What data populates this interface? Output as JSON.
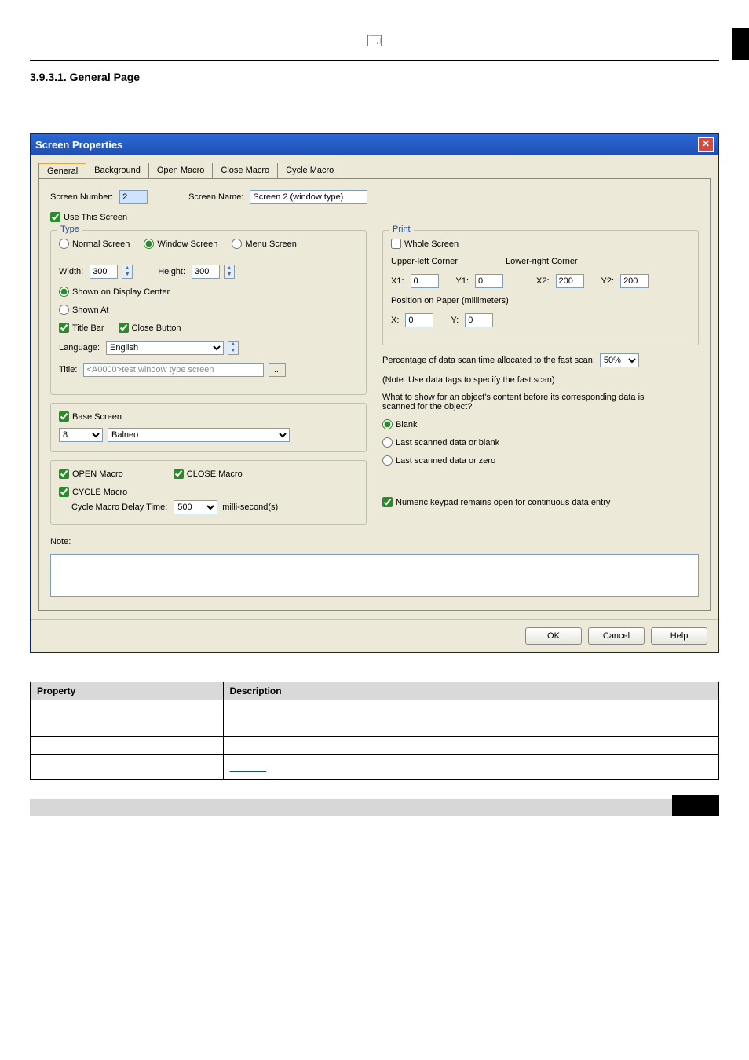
{
  "heading": "3.9.3.1.  General Page",
  "dialog_title": "Screen Properties",
  "tabs": [
    "General",
    "Background",
    "Open Macro",
    "Close Macro",
    "Cycle Macro"
  ],
  "screen_number_label": "Screen Number:",
  "screen_number_value": "2",
  "screen_name_label": "Screen Name:",
  "screen_name_value": "Screen 2 (window type)",
  "use_this_screen": "Use This Screen",
  "type_group": "Type",
  "type_options": [
    "Normal Screen",
    "Window Screen",
    "Menu Screen"
  ],
  "width_label": "Width:",
  "width_value": "300",
  "height_label": "Height:",
  "height_value": "300",
  "shown_center": "Shown on Display Center",
  "shown_at": "Shown At",
  "title_bar": "Title Bar",
  "close_button": "Close Button",
  "language_label": "Language:",
  "language_value": "English",
  "title_label": "Title:",
  "title_value": "<A0000>test window type screen",
  "base_screen": "Base Screen",
  "base_screen_num": "8",
  "base_screen_name": "Balneo",
  "open_macro": "OPEN Macro",
  "close_macro": "CLOSE Macro",
  "cycle_macro": "CYCLE Macro",
  "cycle_delay_label": "Cycle Macro Delay Time:",
  "cycle_delay_value": "500",
  "cycle_delay_unit": "milli-second(s)",
  "note_label": "Note:",
  "print_group": "Print",
  "whole_screen": "Whole Screen",
  "upper_left": "Upper-left Corner",
  "lower_right": "Lower-right Corner",
  "x1_label": "X1:",
  "x1_value": "0",
  "y1_label": "Y1:",
  "y1_value": "0",
  "x2_label": "X2:",
  "x2_value": "200",
  "y2_label": "Y2:",
  "y2_value": "200",
  "pos_paper": "Position on Paper (millimeters)",
  "px_label": "X:",
  "px_value": "0",
  "py_label": "Y:",
  "py_value": "0",
  "fast_scan_label": "Percentage of data scan time allocated to the fast scan:",
  "fast_scan_value": "50%",
  "fast_scan_note": "(Note: Use data tags to specify the fast scan)",
  "show_before_label": "What to show for an object's content before its corresponding data is scanned for the object?",
  "show_opts": [
    "Blank",
    "Last scanned data or blank",
    "Last scanned data or zero"
  ],
  "numeric_keypad": "Numeric keypad remains open for continuous data entry",
  "buttons": {
    "ok": "OK",
    "cancel": "Cancel",
    "help": "Help"
  },
  "table": {
    "headers": [
      "Property",
      "Description"
    ]
  }
}
